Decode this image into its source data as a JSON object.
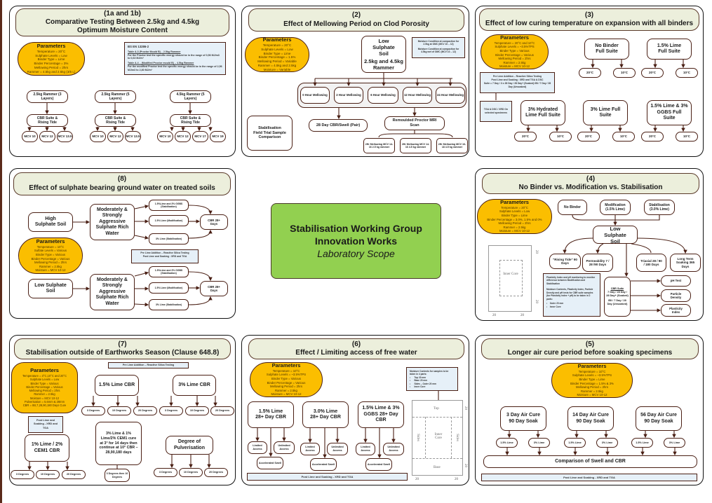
{
  "center": {
    "line1": "Stabilisation Working Group",
    "line2": "Innovation Works",
    "line3": "Laboratory Scope",
    "color": "#92d050"
  },
  "colors": {
    "title_bg": "#ecefdc",
    "params_bg": "#fbbe00",
    "note_bg": "#e6f0f8",
    "border": "#4a1f14"
  },
  "p1": {
    "title_num": "(1a and 1b)",
    "title": "Comparative Testing Between 2.5kg and 4.5kg Optimum Moisture Content",
    "params": {
      "heading": "Parameters",
      "lines": [
        "Temperature = 20°C",
        "Sulphate Levels = Low",
        "Binder Type = Lime",
        "Binder Percentage = 3%",
        "Mellowing Period = 2hrs",
        "Rammer = 4.5kg and 2.5kg (3/5 L)"
      ]
    },
    "note": {
      "heading": "BS EN 13286-2",
      "t1": "Table A.3 (Proctor Mould B) – 2.5kg Rammer",
      "d1": "For the Proctor test the specific energy should be in the range of 0,56 MJ/m3 to 0,63 MJ/m³",
      "t2": "Table A.4 – (Modified Proctor mould B) – 4.5kg Rammer",
      "d2": "For the modified Proctor test the specific energy should be in the range of 2,56 MJ/m3 to 2,80 MJ/m³"
    },
    "groups": [
      {
        "rammer": "2.5kg Rammer (3 Layers)",
        "suite": "CBR Suite & Rising Tide",
        "mcv": [
          "MCV 10",
          "MCV 12",
          "MCV 13.5"
        ]
      },
      {
        "rammer": "2.5kg Rammer (5 Layers)",
        "suite": "CBR Suite & Rising Tide",
        "mcv": [
          "MCV 10",
          "MCV 12",
          "MCV 13.5"
        ]
      },
      {
        "rammer": "4.5kg Rammer (5 Layers)",
        "suite": "CBR Suite & Rising Tide",
        "mcv": [
          "MCV 10",
          "MCV 12",
          "MCV 17",
          "MCV 19"
        ]
      }
    ]
  },
  "p2": {
    "title_num": "(2)",
    "title": "Effect of Mellowing Period on Clod Porosity",
    "params": {
      "heading": "Parameters",
      "lines": [
        "Temperature = 20°C",
        "Sulphate Levels = Low",
        "Binder Type = Lime",
        "Binder Percentage = 1.5%",
        "Mellowing Period = Variable",
        "Rammer = 4.5kg and 2.5kg",
        "Moisture = Variable"
      ]
    },
    "soil": "Low Sulphate Soil",
    "rammer": "2.5kg and 4.5kg Rammer",
    "note": [
      "Moisture Condition at compaction for 2.5kg at OMC (MCV 10 – 12)",
      "Moisture Condition at compaction for 4.5kg wet of OMC (MCV 10 – 12)"
    ],
    "mellowing": [
      "0 Hour Mellowing",
      "2 Hour Mellowing",
      "6 Hour Mellowing",
      "12 Hour Mellowing",
      "24 Hour Mellowing"
    ],
    "cbr": "28 Day CBR/Swell (Pair)",
    "mri": "Remoulded Proctor MRI Scan",
    "field": "Stabilisation Field Trial Sample Comparison",
    "mri_children": [
      "2Hr Mellowing MCV 14-16 2.5 kg rammer",
      "2Hr Mellowing MCV 14-16 4.5 kg rammer",
      "2Hr Mellowing MCV 16-18 4.5 kg rammer"
    ]
  },
  "p3": {
    "title_num": "(3)",
    "title": "Effect of low curing temperature on expansion with all binders",
    "params": {
      "heading": "Parameters",
      "lines": [
        "Temperature = 20°C and 10°C",
        "Sulphate Levels = ~3.5%TPS",
        "Binder Type = Various",
        "Binder Percentage = Various",
        "Mellowing Period = 2hrs",
        "Rammer = 2.5kg",
        "Moisture = MCV 10-12"
      ]
    },
    "note": [
      "Pre Lime Addition – Reactive Silica Testing",
      "Post Lime and Soaking : XRD and TGA & DSC",
      "Suite = 7 Day / 3 x 28 Day / 28 Day+ (Soaked) IBI / 7 Day / 28 Day (Unsoaked)"
    ],
    "note2": "TGA & DSC / XRD On selected specimens",
    "suites": [
      {
        "label": "No Binder Full Suite",
        "temps": [
          "20°C",
          "10°C"
        ]
      },
      {
        "label": "1.5% Lime Full Suite",
        "temps": [
          "20°C",
          "10°C"
        ]
      },
      {
        "label": "3% Hydrated Lime Full Suite",
        "temps": [
          "20°C",
          "10°C"
        ]
      },
      {
        "label": "3% Lime Full Suite",
        "temps": [
          "20°C",
          "10°C"
        ]
      },
      {
        "label": "1.5% Lime & 3% GGBS Full Suite",
        "temps": [
          "20°C",
          "10°C"
        ]
      }
    ]
  },
  "p8": {
    "title_num": "(8)",
    "title": "Effect of sulphate bearing ground water on treated soils",
    "params": {
      "heading": "Parameters",
      "lines": [
        "Temperature = 10°C",
        "Sulfate Levels = Various",
        "Binder Type = Various",
        "Binder Percentage = Various",
        "Mellowing Period = 2hrs",
        "Rammer = 2.5kg",
        "Moisture = MCV 10-12"
      ]
    },
    "rows": [
      {
        "soil": "High Sulphate Soil",
        "water": "Moderately & Strongly Aggressive Sulphate Rich Water",
        "treatments": [
          "1.5%Lime and 3% GGBS (Stabilisation)",
          "1.5% Lime (Modification)",
          "3% Lime (Stabilisation)"
        ],
        "result": "CBR 28+ Days"
      },
      {
        "soil": "Low Sulphate Soil",
        "water": "Moderately & Strongly Aggressive Sulphate Rich Water",
        "treatments": [
          "1.5%Lime and 3% GGBS (Stabilisation)",
          "1.5% Lime (Modification)",
          "3% Lime (Stabilisation)"
        ],
        "result": "CBR 28+ Days"
      }
    ],
    "note": [
      "Pre Lime Addition – Reactive Silica Testing",
      "Post Lime and Soaking : XRD and TGA"
    ]
  },
  "p4": {
    "title_num": "(4)",
    "title": "No Binder vs. Modification vs. Stabilisation",
    "params": {
      "heading": "Parameters",
      "lines": [
        "Temperature = 20°C",
        "Sulphate Levels = Low",
        "Binder Type = Lime",
        "Binder Percentage = 3.0%, 1.5% and 0%",
        "Mellowing Period = 2hrs",
        "Rammer = 2.5kg",
        "Moisture = MCV 10-12"
      ]
    },
    "inputs": [
      "No Binder",
      "Modification (1.5% Lime)",
      "Stabilisation (3.0% Lime)"
    ],
    "soil": "Low Sulphate Soil",
    "tests": [
      "\"Rising Tide\" 90 Days",
      "Permeability 7 / 28 /90 Days",
      "Triaxial 28 / 90 / 180 Days",
      "Long Term Soaking 365 Days"
    ],
    "cbr_suite": {
      "heading": "CBR Suite",
      "soaked": "7 Day / 28 Day / 28 Day+ (Soaked)",
      "unsoaked": "IBI / 7 Day / 28 Day (Unsoaked)"
    },
    "cbr_children": [
      "pH Test",
      "Particle Density",
      "Plasticity Index"
    ],
    "note": {
      "p1": "Plasticity Index and pH monitoring to monitor difference between Modification and Stabilisation",
      "p2": "Moisture Contents, Plasticity Index, Particle Density and pH tests for CBR suite samples (for Plasticity Index + pH) to be taken in 2 parts:",
      "items": [
        "Outer 20 mm",
        "Inner Core"
      ]
    },
    "diagram": {
      "inner": "Inner Core",
      "dims": [
        "20",
        "20",
        "20",
        "20"
      ]
    }
  },
  "p7": {
    "title_num": "(7)",
    "title": "Stabilisation outside of Earthworks Season (Clause 648.8)",
    "params": {
      "heading": "Parameters",
      "lines": [
        "Temperature = 3°C,10°C and 20°C",
        "Sulphate Levels = Low",
        "Binder Type = Various",
        "Binder Percentage = Various",
        "Mellowing Period = 2hrs",
        "Rammer = 2.5kg",
        "Moisture = MCV 10-12",
        "Pulverisation = 5.6mm & 28mm",
        "CBR = IBI,7,28,90,180 Days Cure"
      ]
    },
    "pre_note": "Pre Lime Addition – Reactive Silica Testing",
    "post_note": "Post Lime and Soaking - XRD and TGA",
    "lime15": {
      "label": "1.5% Lime CBR",
      "degrees": [
        "3 Degrees",
        "10 Degrees",
        "20 Degrees"
      ]
    },
    "lime3": {
      "label": "3% Lime CBR",
      "degrees": [
        "3 Degrees",
        "10 Degrees",
        "20 Degrees"
      ]
    },
    "cem": {
      "label": "1% Lime / 2% CEM1 CBR",
      "degrees": [
        "3 Degrees",
        "10 Degrees",
        "20 Degrees"
      ]
    },
    "combo": {
      "label": "3% Lime & 1% Lime/2% CEM1 cure at 3° for 14 days then continue at 10° CBR – 28,90,180 days",
      "child": "3 Degrees then 10 Degrees"
    },
    "pulv": {
      "label": "Degree of Pulverisation",
      "degrees": [
        "3 Degrees",
        "10 Degrees",
        "20 Degrees"
      ]
    }
  },
  "p6": {
    "title_num": "(6)",
    "title": "Effect / Limiting access of free water",
    "params": {
      "heading": "Parameters",
      "lines": [
        "Temperature = 10°C",
        "Sulphate Levels = ~3.5%TPS",
        "Binder Type = Various",
        "Binder Percentage = Various",
        "Mellowing Period = 2hrs",
        "Rammer = 2.5kg",
        "Moisture = MCV 10-12"
      ]
    },
    "groups": [
      {
        "label": "1.5% Lime 28+ Day CBR",
        "a": "Limited Access",
        "b": "Unlimited Access",
        "c": "Accelerated Swell"
      },
      {
        "label": "3.0% Lime 28+ Day CBR",
        "a": "Limited Access",
        "b": "Unlimited Access",
        "c": "Accelerated Swell"
      },
      {
        "label": "1.5% Lime & 3% GGBS 28+ Day CBR",
        "a": "Limited Access",
        "b": "Unlimited Access",
        "c": "Accelerated Swell"
      }
    ],
    "note": {
      "heading": "Moisture Contents for samples to be taken in 4 parts:",
      "items": [
        "Top 20 mm",
        "Base 20 mm",
        "Sides – Outer 20 mm",
        "Inner Core"
      ]
    },
    "diagram": {
      "top": "Top",
      "base": "Base",
      "sides": "Sides",
      "inner": "Inner Core",
      "dims": [
        "20",
        "20",
        "20",
        "20"
      ]
    },
    "footer": "Post Lime and Soaking - XRD and TGA"
  },
  "p5": {
    "title_num": "(5)",
    "title": "Longer air cure period before soaking specimens",
    "params": {
      "heading": "Parameters",
      "lines": [
        "Temperature = 10°C",
        "Sulphate Levels = ~3.5%TPS",
        "Binder Type = Lime",
        "Binder Percentage = 1.5% & 3%",
        "Mellowing Period = 2hrs",
        "Rammer = 2.5kg",
        "Moisture = MCV 10-12"
      ]
    },
    "groups": [
      {
        "label": "3 Day Air Cure 90 Day Soak",
        "a": "1.5% Lime",
        "b": "3% Lime"
      },
      {
        "label": "14 Day Air Cure 90 Day Soak",
        "a": "1.5% Lime",
        "b": "3% Lime"
      },
      {
        "label": "56 Day Air Cure 90 Day Soak",
        "a": "1.5% Lime",
        "b": "3% Lime"
      }
    ],
    "comparison": "Comparison of Swell and CBR",
    "footer": "Post Lime and Soaking - XRD and TGA"
  }
}
